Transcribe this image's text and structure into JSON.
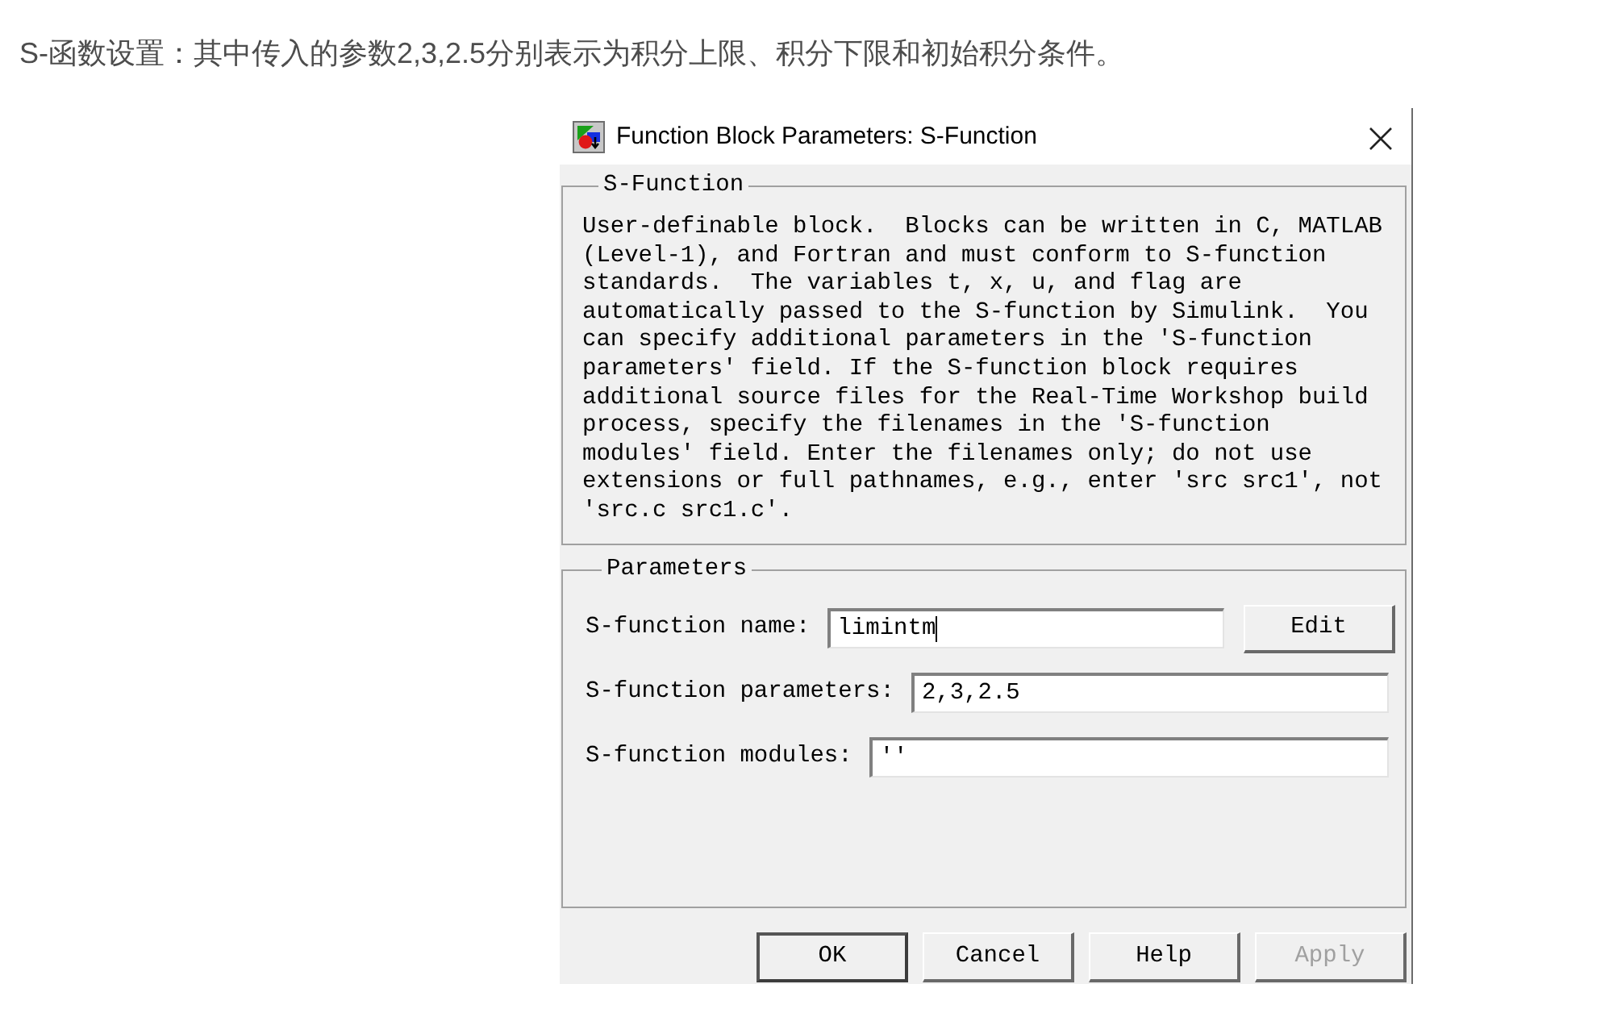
{
  "caption": "S-函数设置：其中传入的参数2,3,2.5分别表示为积分上限、积分下限和初始积分条件。",
  "window": {
    "title": "Function Block Parameters: S-Function"
  },
  "description_group": {
    "title": "S-Function",
    "text": "User-definable block.  Blocks can be written in C, MATLAB\n(Level-1), and Fortran and must conform to S-function\nstandards.  The variables t, x, u, and flag are\nautomatically passed to the S-function by Simulink.  You\ncan specify additional parameters in the 'S-function\nparameters' field. If the S-function block requires\nadditional source files for the Real-Time Workshop build\nprocess, specify the filenames in the 'S-function\nmodules' field. Enter the filenames only; do not use\nextensions or full pathnames, e.g., enter 'src src1', not\n'src.c src1.c'."
  },
  "parameters_group": {
    "title": "Parameters",
    "fields": [
      {
        "label": "S-function name:",
        "value": "limintm",
        "focused": true,
        "button": "Edit"
      },
      {
        "label": "S-function parameters:",
        "value": "2,3,2.5",
        "focused": false
      },
      {
        "label": "S-function modules:",
        "value": "''",
        "focused": false
      }
    ]
  },
  "buttons": [
    {
      "label": "OK",
      "default": true,
      "disabled": false
    },
    {
      "label": "Cancel",
      "default": false,
      "disabled": false
    },
    {
      "label": "Help",
      "default": false,
      "disabled": false
    },
    {
      "label": "Apply",
      "default": false,
      "disabled": true
    }
  ]
}
